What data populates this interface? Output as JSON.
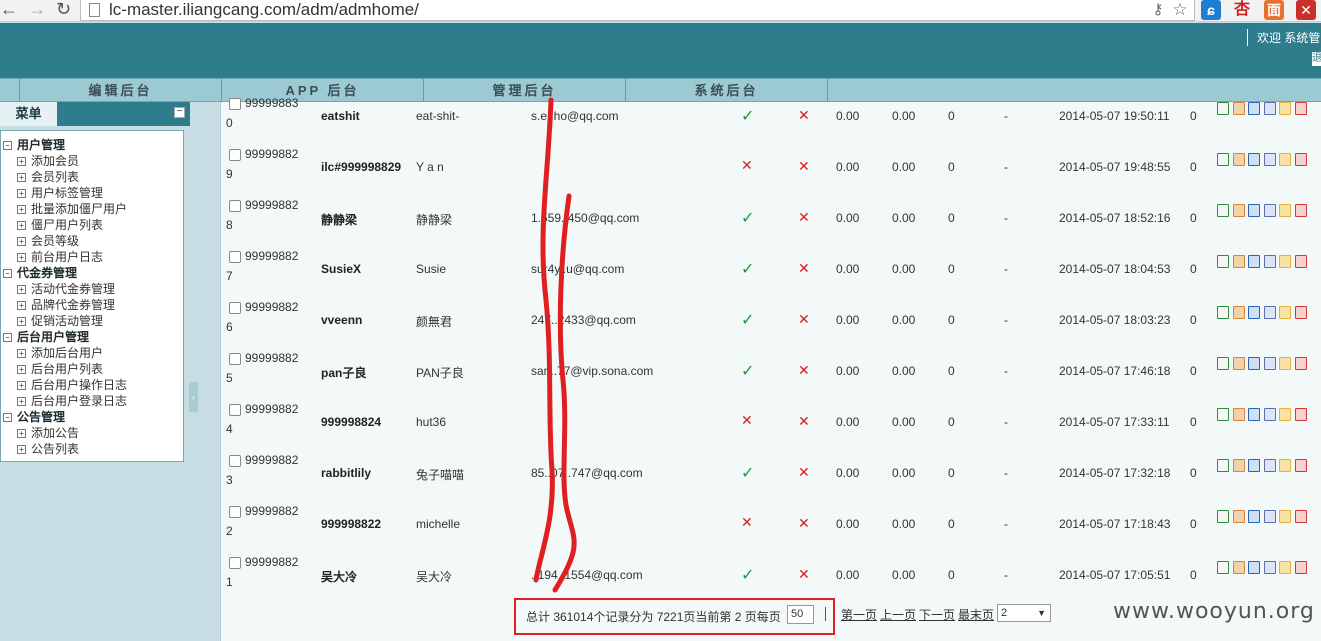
{
  "browser": {
    "url": "lc-master.iliangcang.com/adm/admhome/",
    "ext_icons": [
      "key-icon",
      "star-icon",
      "ext-blue-icon",
      "ext-xing-icon",
      "ext-orange-icon",
      "ext-close-icon"
    ]
  },
  "header": {
    "welcome": "欢迎 系统管"
  },
  "nav_tabs": [
    "编辑后台",
    "APP 后台",
    "管理后台",
    "系统后台"
  ],
  "sidebar": {
    "title": "菜单",
    "groups": [
      {
        "label": "用户管理",
        "items": [
          "添加会员",
          "会员列表",
          "用户标签管理",
          "批量添加僵尸用户",
          "僵尸用户列表",
          "会员等级",
          "前台用户日志"
        ]
      },
      {
        "label": "代金券管理",
        "items": [
          "活动代金券管理",
          "品牌代金券管理",
          "促销活动管理"
        ]
      },
      {
        "label": "后台用户管理",
        "items": [
          "添加后台用户",
          "后台用户列表",
          "后台用户操作日志",
          "后台用户登录日志"
        ]
      },
      {
        "label": "公告管理",
        "items": [
          "添加公告",
          "公告列表"
        ]
      }
    ]
  },
  "table": {
    "rows": [
      {
        "id_a": "99999883",
        "id_b": "0",
        "username": "eatshit",
        "nickname": "eat-shit-",
        "email": "s.e..ho@qq.com",
        "s1": "check",
        "s2": "cross",
        "v1": "0.00",
        "v2": "0.00",
        "v3": "0",
        "v4": "-",
        "time": "2014-05-07 19:50:11",
        "v5": "0"
      },
      {
        "id_a": "99999882",
        "id_b": "9",
        "username": "ilc#999998829",
        "nickname": "Y a n",
        "email": "",
        "s1": "cross",
        "s2": "cross",
        "v1": "0.00",
        "v2": "0.00",
        "v3": "0",
        "v4": "-",
        "time": "2014-05-07 19:48:55",
        "v5": "0"
      },
      {
        "id_a": "99999882",
        "id_b": "8",
        "username": "静静梁",
        "nickname": "静静梁",
        "email": "1.559..450@qq.com",
        "s1": "check",
        "s2": "cross",
        "v1": "0.00",
        "v2": "0.00",
        "v3": "0",
        "v4": "-",
        "time": "2014-05-07 18:52:16",
        "v5": "0"
      },
      {
        "id_a": "99999882",
        "id_b": "7",
        "username": "SusieX",
        "nickname": "Susie",
        "email": "sur4y..u@qq.com",
        "s1": "check",
        "s2": "cross",
        "v1": "0.00",
        "v2": "0.00",
        "v3": "0",
        "v4": "-",
        "time": "2014-05-07 18:04:53",
        "v5": "0"
      },
      {
        "id_a": "99999882",
        "id_b": "6",
        "username": "vveenn",
        "nickname": "颜無君",
        "email": "247..2433@qq.com",
        "s1": "check",
        "s2": "cross",
        "v1": "0.00",
        "v2": "0.00",
        "v3": "0",
        "v4": "-",
        "time": "2014-05-07 18:03:23",
        "v5": "0"
      },
      {
        "id_a": "99999882",
        "id_b": "5",
        "username": "pan子良",
        "nickname": "PAN子良",
        "email": "san..77@vip.sona.com",
        "s1": "check",
        "s2": "cross",
        "v1": "0.00",
        "v2": "0.00",
        "v3": "0",
        "v4": "-",
        "time": "2014-05-07 17:46:18",
        "v5": "0"
      },
      {
        "id_a": "99999882",
        "id_b": "4",
        "username": "999998824",
        "nickname": "hut36",
        "email": "",
        "s1": "cross",
        "s2": "cross",
        "v1": "0.00",
        "v2": "0.00",
        "v3": "0",
        "v4": "-",
        "time": "2014-05-07 17:33:11",
        "v5": "0"
      },
      {
        "id_a": "99999882",
        "id_b": "3",
        "username": "rabbitlily",
        "nickname": "兔子喵喵",
        "email": "85..07..747@qq.com",
        "s1": "check",
        "s2": "cross",
        "v1": "0.00",
        "v2": "0.00",
        "v3": "0",
        "v4": "-",
        "time": "2014-05-07 17:32:18",
        "v5": "0"
      },
      {
        "id_a": "99999882",
        "id_b": "2",
        "username": "999998822",
        "nickname": "michelle",
        "email": "",
        "s1": "cross",
        "s2": "cross",
        "v1": "0.00",
        "v2": "0.00",
        "v3": "0",
        "v4": "-",
        "time": "2014-05-07 17:18:43",
        "v5": "0"
      },
      {
        "id_a": "99999882",
        "id_b": "1",
        "username": "吴大冷",
        "nickname": "吴大冷",
        "email": "..194..1554@qq.com",
        "s1": "check",
        "s2": "cross",
        "v1": "0.00",
        "v2": "0.00",
        "v3": "0",
        "v4": "-",
        "time": "2014-05-07 17:05:51",
        "v5": "0"
      }
    ],
    "row_ops": [
      "edit-icon",
      "users-icon",
      "book-icon",
      "doc-icon",
      "folder-icon",
      "delete-icon"
    ]
  },
  "pager": {
    "summary": "总计 361014个记录分为 7221页当前第 2 页每页",
    "page_size": "50",
    "first": "第一页",
    "prev": "上一页",
    "next": "下一页",
    "last": "最末页",
    "selected_page": "2"
  },
  "watermark": "www.wooyun.org",
  "colors": {
    "header": "#2f7d8c",
    "check": "#1e9a3c",
    "cross": "#d82020",
    "annotation": "#e02020"
  }
}
